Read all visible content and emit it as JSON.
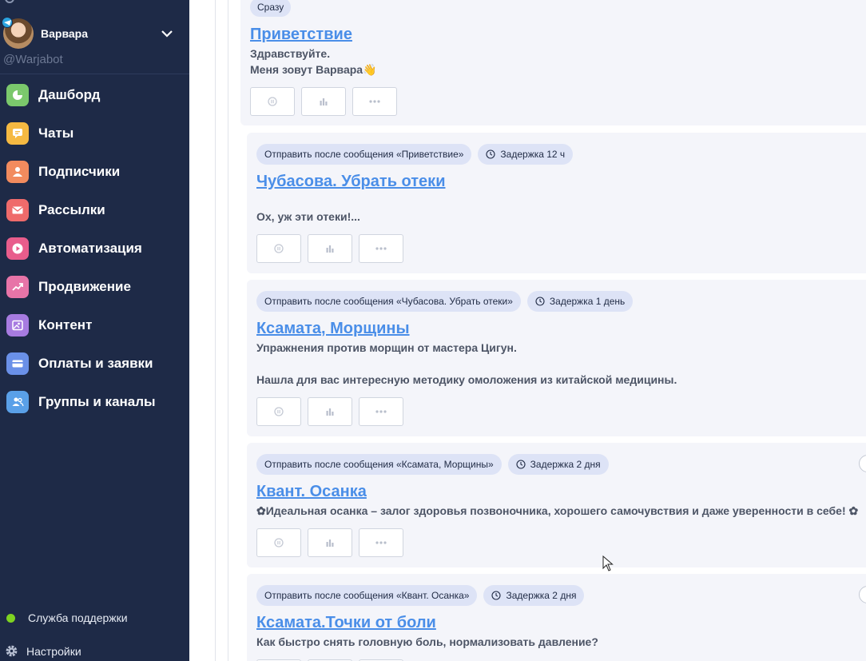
{
  "sidebar": {
    "user_name": "Варвара",
    "handle": "@Warjabot",
    "items": [
      {
        "label": "Дашборд",
        "icon": "pie-chart-icon",
        "color": "#7bc86c"
      },
      {
        "label": "Чаты",
        "icon": "chat-icon",
        "color": "#f5b942"
      },
      {
        "label": "Подписчики",
        "icon": "user-icon",
        "color": "#f28b5e"
      },
      {
        "label": "Рассылки",
        "icon": "mail-icon",
        "color": "#ef6b6b"
      },
      {
        "label": "Автоматизация",
        "icon": "play-icon",
        "color": "#e85d8c"
      },
      {
        "label": "Продвижение",
        "icon": "trending-up-icon",
        "color": "#e774a8"
      },
      {
        "label": "Контент",
        "icon": "image-icon",
        "color": "#a77be0"
      },
      {
        "label": "Оплаты и заявки",
        "icon": "card-icon",
        "color": "#6a90e8"
      },
      {
        "label": "Группы и каналы",
        "icon": "group-icon",
        "color": "#5aa0e8"
      }
    ],
    "support_label": "Служба поддержки",
    "settings_label": "Настройки"
  },
  "messages": [
    {
      "tag": "Сразу",
      "delay": "",
      "title": "Приветствие",
      "lines": [
        "Здравствуйте.",
        "Меня зовут Варвара👋"
      ]
    },
    {
      "tag": "Отправить после сообщения «Приветствие»",
      "delay": "Задержка 12 ч",
      "title": "Чубасова. Убрать отеки",
      "lines": [
        "Ох, уж эти отеки!..."
      ]
    },
    {
      "tag": "Отправить после сообщения «Чубасова. Убрать отеки»",
      "delay": "Задержка 1 день",
      "title": "Ксамата, Морщины",
      "lines": [
        "Упражнения против морщин от мастера Цигун.",
        "Нашла для вас интересную методику омоложения из китайской медицины."
      ]
    },
    {
      "tag": "Отправить после сообщения «Ксамата, Морщины»",
      "delay": "Задержка 2 дня",
      "title": "Квант. Осанка",
      "lines": [
        "✿Идеальная осанка – залог здоровья позвоночника, хорошего самочувствия и даже уверенности в себе! ✿"
      ]
    },
    {
      "tag": "Отправить после сообщения «Квант. Осанка»",
      "delay": "Задержка 2 дня",
      "title": "Ксамата.Точки от боли",
      "lines": [
        "Как быстро снять головную боль, нормализовать давление?"
      ]
    }
  ]
}
